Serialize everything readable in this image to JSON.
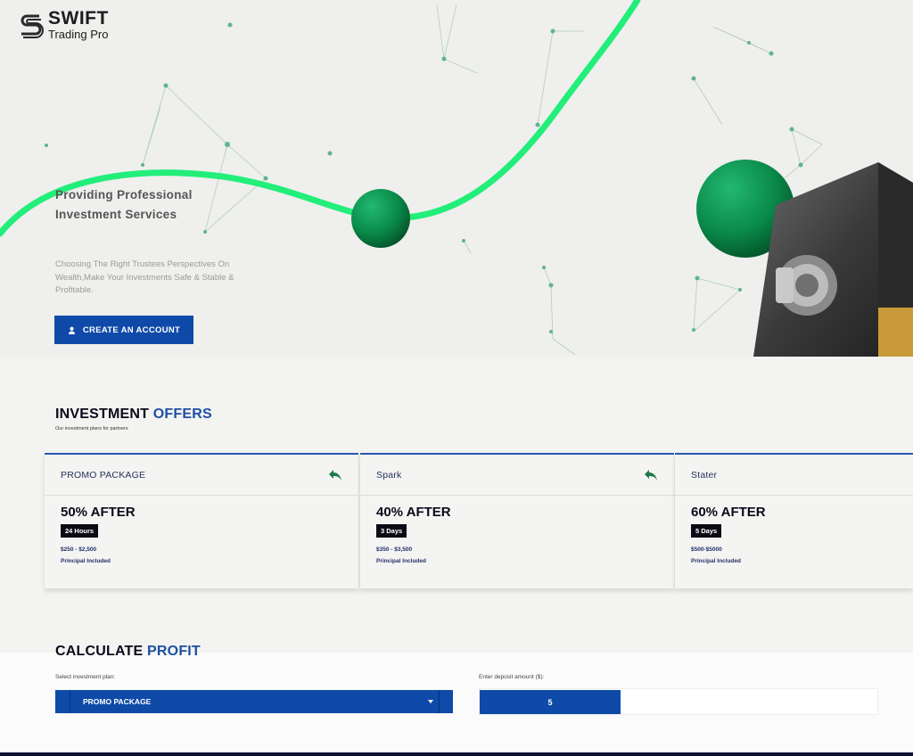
{
  "brand": {
    "name": "SWIFT",
    "tagline": "Trading Pro"
  },
  "hero": {
    "title": "Providing Professional Investment Services",
    "description": "Choosing The Right Trustees Perspectives On Wealth,Make Your Investments Safe & Stable & Profitable.",
    "cta_label": "CREATE AN ACCOUNT"
  },
  "offers": {
    "title_main": "INVESTMENT",
    "title_highlight": "OFFERS",
    "subtitle": "Our investment plans for partners",
    "plans": [
      {
        "name": "PROMO PACKAGE",
        "percent": "50% AFTER",
        "duration": "24 Hours",
        "range": "$250 - $2,500",
        "principal": "Principal Included",
        "has_icon": true
      },
      {
        "name": "Spark",
        "percent": "40% AFTER",
        "duration": "3 Days",
        "range": "$350 - $3,500",
        "principal": "Principal Included",
        "has_icon": true
      },
      {
        "name": "Stater",
        "percent": "60% AFTER",
        "duration": "5 Days",
        "range": "$500-$5000",
        "principal": "Principal Included",
        "has_icon": false
      }
    ]
  },
  "calculator": {
    "title_main": "CALCULATE",
    "title_highlight": "PROFIT",
    "plan_label": "Select investment plan:",
    "plan_value": "PROMO PACKAGE",
    "amount_label": "Enter deposit amount ($):",
    "amount_value": "5"
  },
  "colors": {
    "accent": "#0f4aa8",
    "highlight_text": "#1d4fa3",
    "curve": "#22ee7a",
    "sphere": "#0a8a4a"
  }
}
